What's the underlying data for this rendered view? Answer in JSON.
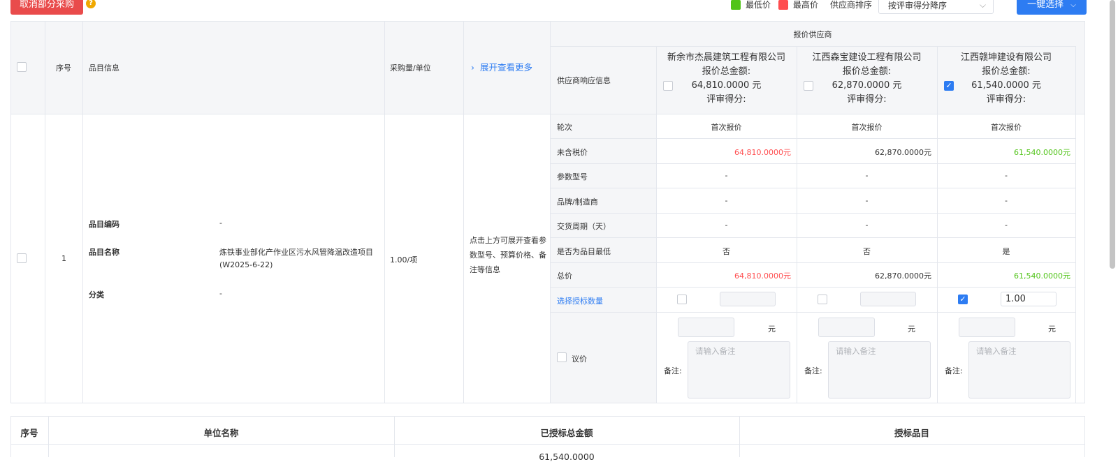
{
  "toolbar": {
    "cancel_label": "取消部分采购",
    "legend_low": "最低价",
    "legend_high": "最高价",
    "sort_label": "供应商排序",
    "sort_value": "按评审得分降序",
    "select_all_label": "一键选择",
    "colors": {
      "low": "#52c41a",
      "high": "#ff4d4f",
      "accent": "#2d7cf2"
    }
  },
  "table": {
    "headers": {
      "seq": "序号",
      "item_info": "品目信息",
      "qty_unit": "采购量/单位",
      "expand": "展开查看更多",
      "quoted_suppliers": "报价供应商",
      "response_info": "供应商响应信息"
    },
    "suppliers": [
      {
        "name": "新余市杰晨建筑工程有限公司",
        "total_label": "报价总金额:",
        "total": "64,810.0000 元",
        "score_label": "评审得分:",
        "checked": false
      },
      {
        "name": "江西森宝建设工程有限公司",
        "total_label": "报价总金额:",
        "total": "62,870.0000 元",
        "score_label": "评审得分:",
        "checked": false
      },
      {
        "name": "江西赣坤建设有限公司",
        "total_label": "报价总金额:",
        "total": "61,540.0000 元",
        "score_label": "评审得分:",
        "checked": true
      }
    ],
    "row": {
      "seq": "1",
      "code_label": "品目编码",
      "code_value": "-",
      "name_label": "品目名称",
      "name_value_1": "炼铁事业部化产作业区污水风管降温改造项目",
      "name_value_2": "(W2025-6-22)",
      "category_label": "分类",
      "category_value": "-",
      "qty": "1.00/项",
      "hint_1": "点击上方可展开查看参",
      "hint_2": "数型号、预算价格、备",
      "hint_3": "注等信息"
    },
    "attrs": [
      {
        "label": "轮次",
        "values": [
          "首次报价",
          "首次报价",
          "首次报价"
        ]
      },
      {
        "label": "未含税价",
        "values": [
          "64,810.0000元",
          "62,870.0000元",
          "61,540.0000元"
        ]
      },
      {
        "label": "参数型号",
        "values": [
          "-",
          "-",
          "-"
        ]
      },
      {
        "label": "品牌/制造商",
        "values": [
          "-",
          "-",
          "-"
        ]
      },
      {
        "label": "交货周期（天）",
        "values": [
          "-",
          "-",
          "-"
        ]
      },
      {
        "label": "是否为品目最低",
        "values": [
          "否",
          "否",
          "是"
        ]
      },
      {
        "label": "总价",
        "values": [
          "64,810.0000元",
          "62,870.0000元",
          "61,540.0000元"
        ]
      }
    ],
    "award_qty_label": "选择授标数量",
    "award_qty_value": "1.00",
    "negotiate_label": "议价",
    "yuan": "元",
    "remark_label": "备注:",
    "remark_placeholder": "请输入备注"
  },
  "summary": {
    "headers": [
      "序号",
      "单位名称",
      "已授标总金额",
      "授标品目"
    ],
    "partial_amount": "61,540.0000"
  }
}
